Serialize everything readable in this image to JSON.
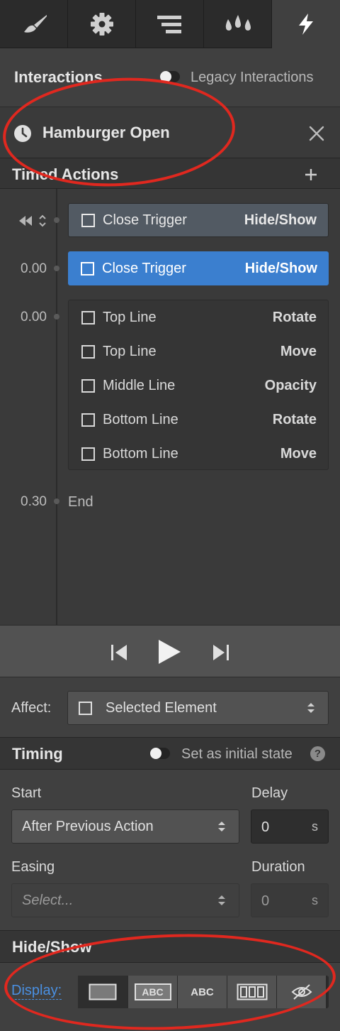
{
  "tabs": [
    {
      "icon": "paintbrush-icon"
    },
    {
      "icon": "gear-icon"
    },
    {
      "icon": "list-icon"
    },
    {
      "icon": "drops-icon"
    },
    {
      "icon": "lightning-icon",
      "active": true
    }
  ],
  "header": {
    "title": "Interactions",
    "legacy_label": "Legacy Interactions"
  },
  "interaction": {
    "name": "Hamburger Open"
  },
  "timed_actions": {
    "title": "Timed Actions",
    "rows": [
      {
        "time": "",
        "name": "Close Trigger",
        "verb": "Hide/Show",
        "state": "initial"
      },
      {
        "time": "0.00",
        "name": "Close Trigger",
        "verb": "Hide/Show",
        "state": "selected"
      }
    ],
    "group_time": "0.00",
    "group": [
      {
        "name": "Top Line",
        "verb": "Rotate"
      },
      {
        "name": "Top Line",
        "verb": "Move"
      },
      {
        "name": "Middle Line",
        "verb": "Opacity"
      },
      {
        "name": "Bottom Line",
        "verb": "Rotate"
      },
      {
        "name": "Bottom Line",
        "verb": "Move"
      }
    ],
    "end_time": "0.30",
    "end_label": "End"
  },
  "affect": {
    "label": "Affect:",
    "value": "Selected Element"
  },
  "timing": {
    "title": "Timing",
    "initial_state_label": "Set as initial state",
    "help": "?",
    "start_label": "Start",
    "start_value": "After Previous Action",
    "delay_label": "Delay",
    "delay_value": "0",
    "delay_unit": "s",
    "easing_label": "Easing",
    "easing_placeholder": "Select...",
    "duration_label": "Duration",
    "duration_value": "0",
    "duration_unit": "s"
  },
  "hide_show": {
    "title": "Hide/Show",
    "display_label": "Display:",
    "options": [
      "block-icon",
      "inline-block-icon",
      "inline-icon",
      "flex-icon",
      "none-icon"
    ],
    "inline_block_text": "ABC",
    "inline_text": "ABC"
  },
  "colors": {
    "accent": "#3b7fcf",
    "annotation": "#e0281f"
  }
}
